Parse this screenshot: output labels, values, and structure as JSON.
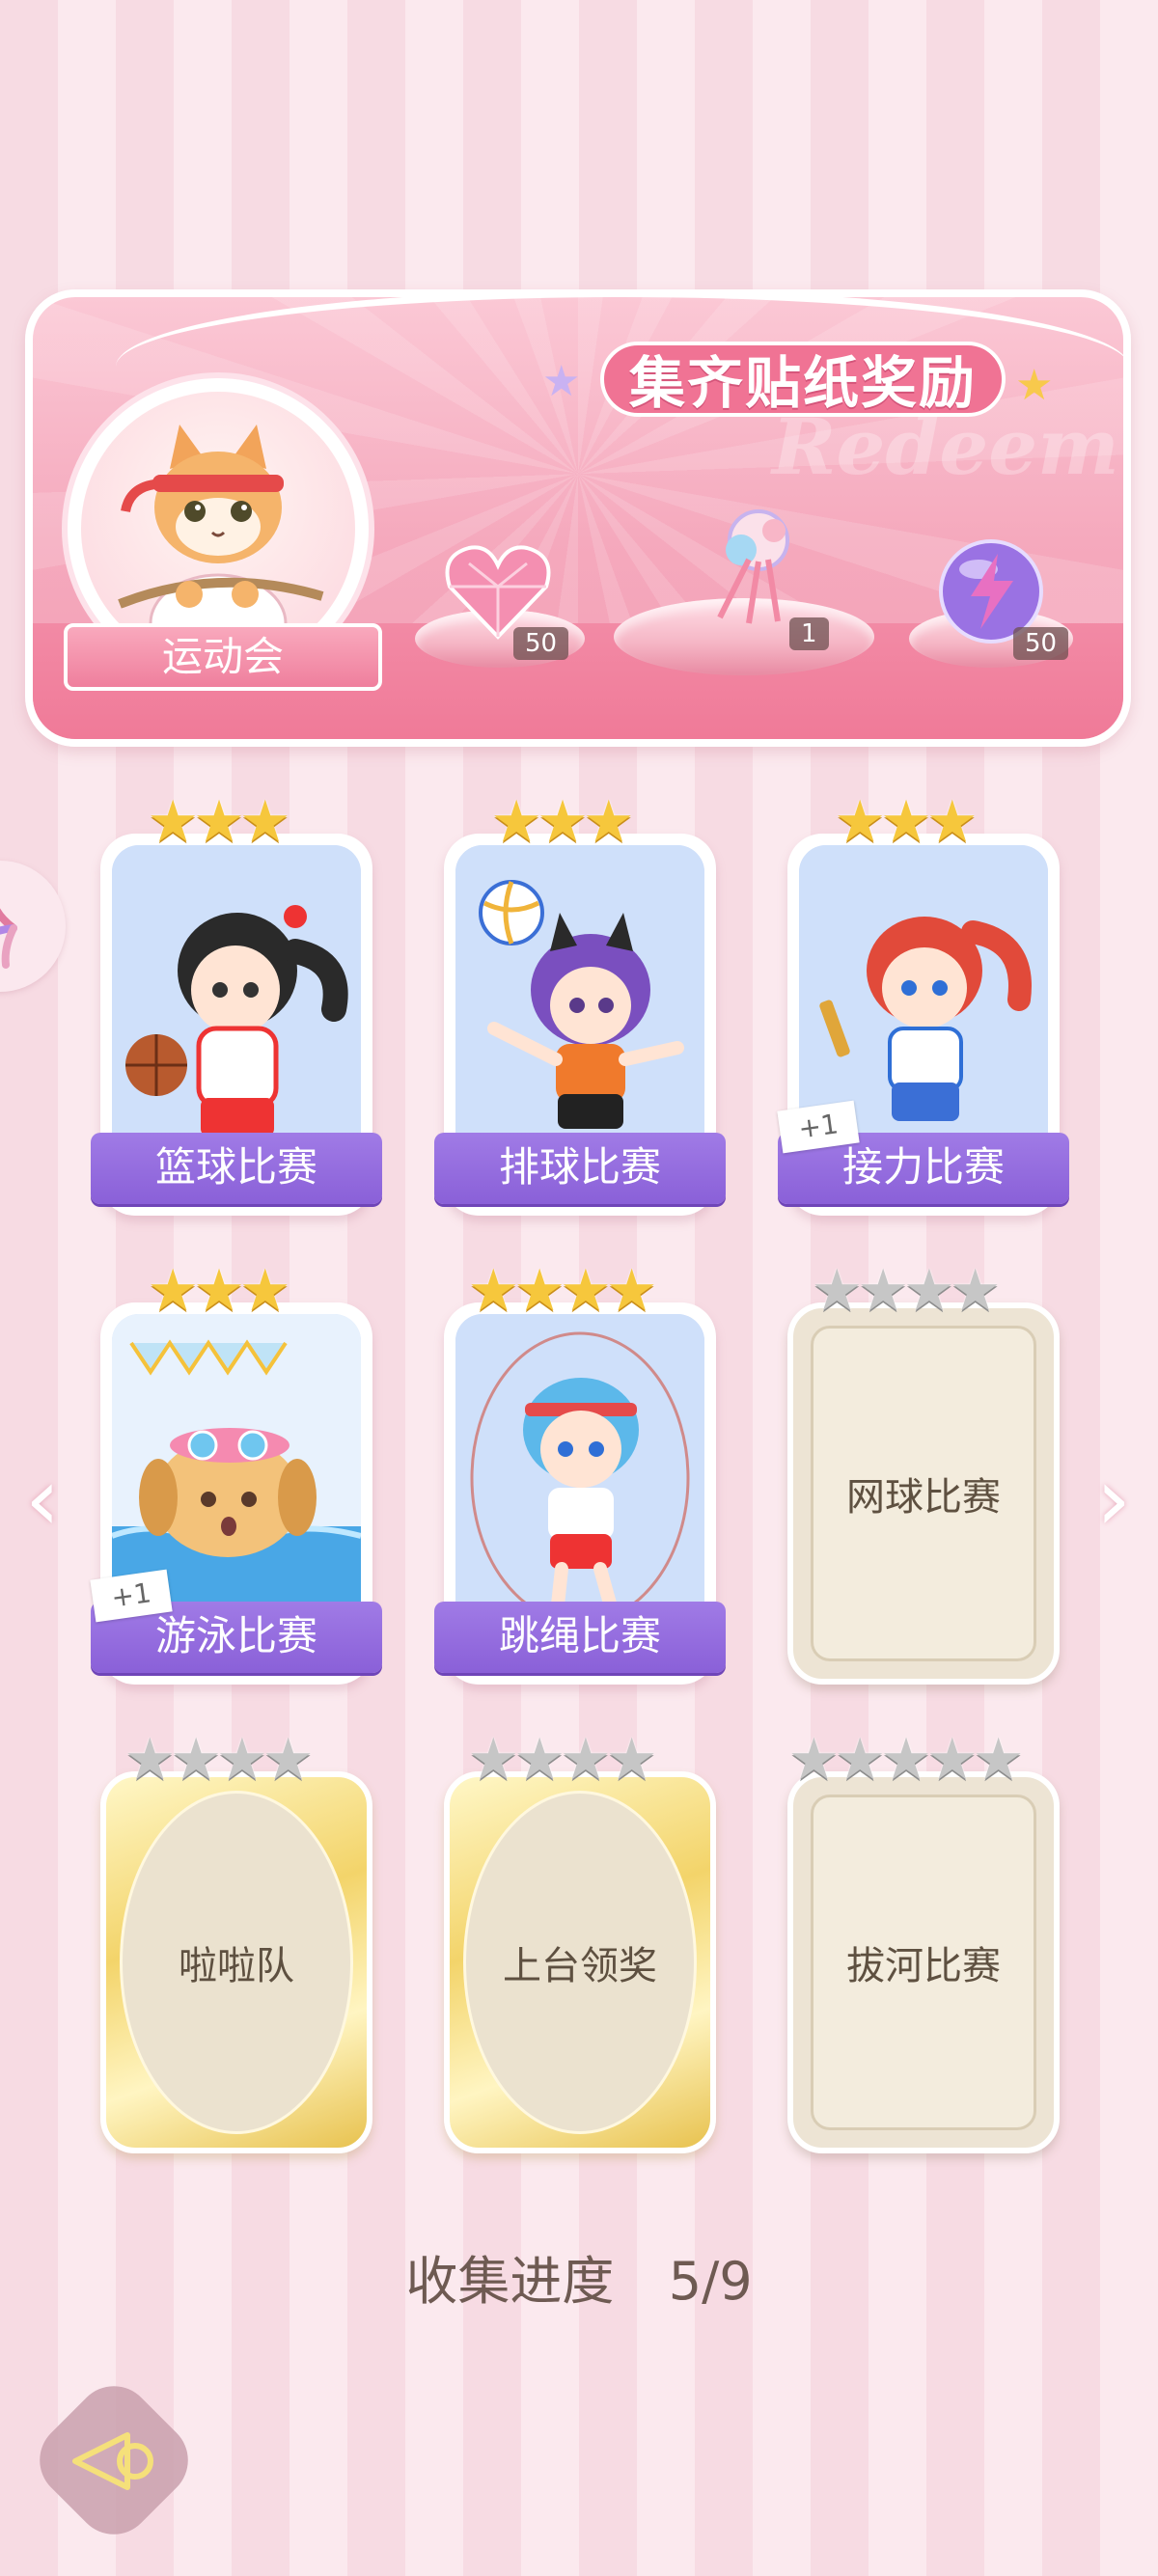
{
  "banner": {
    "title": "集齐贴纸奖励",
    "watermark": "Redeem",
    "event_name": "运动会",
    "rewards": [
      {
        "icon": "heart-gem-icon",
        "count": "50"
      },
      {
        "icon": "ribbon-bouquet-icon",
        "count": "1"
      },
      {
        "icon": "lightning-orb-icon",
        "count": "50"
      }
    ]
  },
  "cards": [
    {
      "label": "篮球比赛",
      "stars": 3,
      "max_stars": 3,
      "collected": true,
      "badge": ""
    },
    {
      "label": "排球比赛",
      "stars": 3,
      "max_stars": 3,
      "collected": true,
      "badge": ""
    },
    {
      "label": "接力比赛",
      "stars": 3,
      "max_stars": 3,
      "collected": true,
      "badge": "+1"
    },
    {
      "label": "游泳比赛",
      "stars": 3,
      "max_stars": 3,
      "collected": true,
      "badge": "+1"
    },
    {
      "label": "跳绳比赛",
      "stars": 4,
      "max_stars": 4,
      "collected": true,
      "badge": ""
    },
    {
      "label": "网球比赛",
      "stars": 0,
      "max_stars": 4,
      "collected": false,
      "frame": "classic"
    },
    {
      "label": "啦啦队",
      "stars": 0,
      "max_stars": 4,
      "collected": false,
      "frame": "gold"
    },
    {
      "label": "上台领奖",
      "stars": 0,
      "max_stars": 4,
      "collected": false,
      "frame": "gold"
    },
    {
      "label": "拔河比赛",
      "stars": 0,
      "max_stars": 5,
      "collected": false,
      "frame": "classic"
    }
  ],
  "progress": {
    "label": "收集进度",
    "value": "5/9"
  },
  "colors": {
    "label_purple": "#8a60d8",
    "banner_pink": "#f5a9bd",
    "star_gold": "#f6c73c",
    "star_gray": "#c6c6c6"
  }
}
